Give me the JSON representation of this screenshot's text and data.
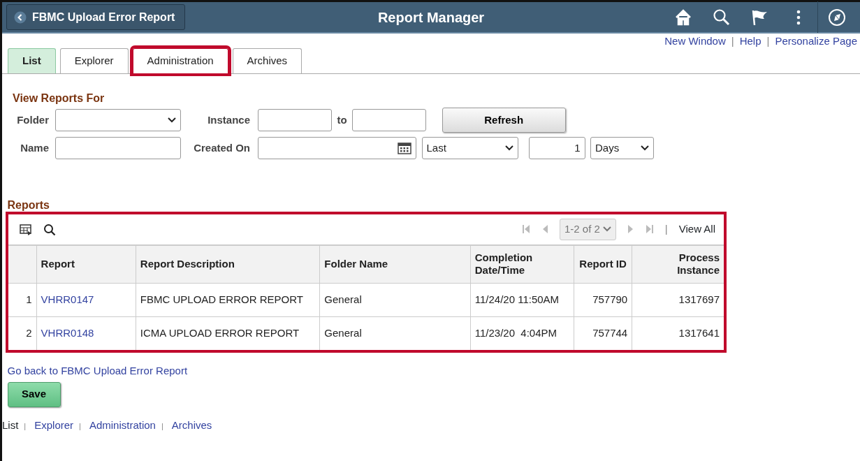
{
  "header": {
    "back_button": "FBMC Upload Error Report",
    "title": "Report Manager"
  },
  "top_links": [
    {
      "label": "New Window"
    },
    {
      "separator": "|",
      "label": "Help"
    },
    {
      "separator": "|",
      "label": "Personalize Page"
    }
  ],
  "tabs": [
    {
      "label": "List",
      "selected": true,
      "highlighted": false
    },
    {
      "label": "Explorer",
      "selected": false,
      "highlighted": false
    },
    {
      "label": "Administration",
      "selected": false,
      "highlighted": true
    },
    {
      "label": "Archives",
      "selected": false,
      "highlighted": false
    }
  ],
  "filters": {
    "heading": "View Reports For",
    "folder_label": "Folder",
    "instance_label": "Instance",
    "to_label": "to",
    "refresh_button": "Refresh",
    "name_label": "Name",
    "created_on_label": "Created On",
    "period": "Last",
    "count": "1",
    "unit": "Days"
  },
  "reports": {
    "heading": "Reports",
    "highlighted": true,
    "pager": "1-2 of 2",
    "separator": "|",
    "view_all": "View All",
    "columns": [
      "Report",
      "Report Description",
      "Folder Name",
      "Completion Date/Time",
      "Report ID",
      "Process Instance"
    ],
    "rows": [
      {
        "number": "1",
        "report": "VHRR0147",
        "description": "FBMC UPLOAD ERROR REPORT",
        "folder": "General",
        "completed": "11/24/20 11:50AM",
        "report_id": "757790",
        "process_instance": "1317697"
      },
      {
        "number": "2",
        "report": "VHRR0148",
        "description": "ICMA UPLOAD ERROR REPORT",
        "folder": "General",
        "completed": "11/23/20  4:04PM",
        "report_id": "757744",
        "process_instance": "1317641"
      }
    ]
  },
  "back_link": "Go back to FBMC Upload Error Report",
  "save_button": "Save",
  "footer_links": [
    {
      "label": "List",
      "selected": true
    },
    {
      "separator": "|",
      "label": "Explorer",
      "selected": false
    },
    {
      "separator": "|",
      "label": "Administration",
      "selected": false
    },
    {
      "separator": "|",
      "label": "Archives",
      "selected": false
    }
  ]
}
